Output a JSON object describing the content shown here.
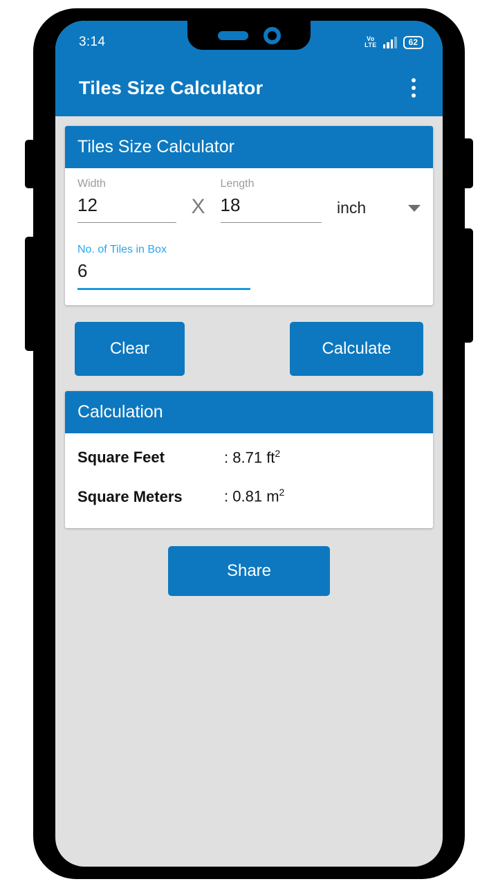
{
  "status_bar": {
    "time": "3:14",
    "network_label_top": "Vo",
    "network_label_bottom": "LTE",
    "battery_level": "62",
    "signal_icon": "signal-bars-icon",
    "volte_icon": "volte-icon",
    "battery_icon": "battery-icon"
  },
  "app_bar": {
    "title": "Tiles Size Calculator",
    "overflow_icon": "more-vert-icon"
  },
  "input_card": {
    "header": "Tiles Size Calculator",
    "width": {
      "label": "Width",
      "value": "12"
    },
    "separator": "X",
    "length": {
      "label": "Length",
      "value": "18"
    },
    "unit": {
      "value": "inch",
      "caret_icon": "chevron-down-icon"
    },
    "tiles_in_box": {
      "label": "No. of Tiles in Box",
      "value": "6"
    }
  },
  "actions": {
    "clear_label": "Clear",
    "calculate_label": "Calculate"
  },
  "calculation_card": {
    "header": "Calculation",
    "rows": [
      {
        "label": "Square Feet",
        "separator": ": ",
        "value": "8.71",
        "unit": "ft",
        "exponent": "2"
      },
      {
        "label": "Square Meters",
        "separator": ": ",
        "value": "0.81",
        "unit": "m",
        "exponent": "2"
      }
    ]
  },
  "share": {
    "label": "Share"
  },
  "colors": {
    "primary_blue": "#0d78bf",
    "accent_blue": "#1e9bdc",
    "label_blue": "#29a7e8",
    "screen_background": "#e0e0e0",
    "card_background": "#ffffff",
    "frame_black": "#000000",
    "text_dark": "#111111",
    "label_gray": "#9b9b9b"
  }
}
